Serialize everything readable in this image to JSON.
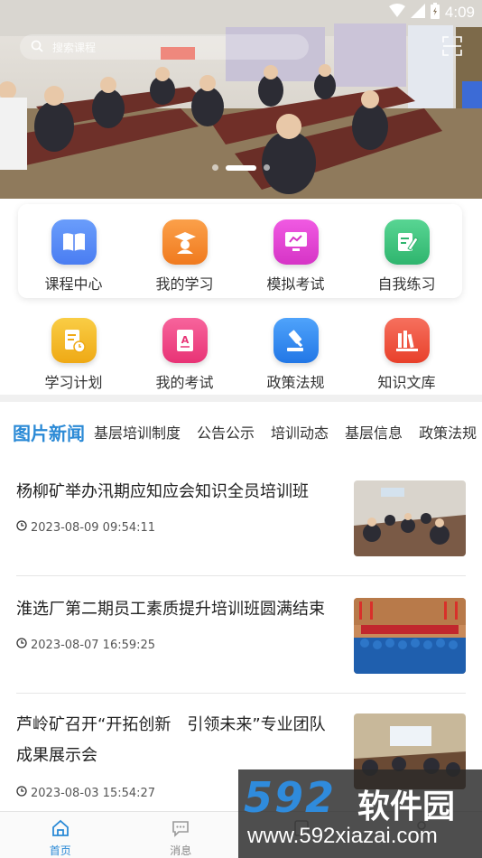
{
  "status_bar": {
    "time": "4:09"
  },
  "search": {
    "placeholder": "搜索课程"
  },
  "feature_row1": [
    {
      "label": "课程中心",
      "color": "#4f86f7",
      "icon": "book-icon"
    },
    {
      "label": "我的学习",
      "color": "#f5892b",
      "icon": "graduate-icon"
    },
    {
      "label": "模拟考试",
      "color": "#e43fd6",
      "icon": "monitor-icon"
    },
    {
      "label": "自我练习",
      "color": "#3fc37e",
      "icon": "edit-note-icon"
    }
  ],
  "feature_row2": [
    {
      "label": "学习计划",
      "color": "#f3b82a",
      "icon": "plan-icon"
    },
    {
      "label": "我的考试",
      "color": "#f04a86",
      "icon": "exam-icon"
    },
    {
      "label": "政策法规",
      "color": "#2f8ef3",
      "icon": "gavel-icon"
    },
    {
      "label": "知识文库",
      "color": "#f2543f",
      "icon": "library-icon"
    }
  ],
  "tabs": [
    "图片新闻",
    "基层培训制度",
    "公告公示",
    "培训动态",
    "基层信息",
    "政策法规"
  ],
  "news": [
    {
      "title": "杨柳矿举办汛期应知应会知识全员培训班",
      "time": "2023-08-09 09:54:11"
    },
    {
      "title": "淮选厂第二期员工素质提升培训班圆满结束",
      "time": "2023-08-07 16:59:25"
    },
    {
      "title": "芦岭矿召开“开拓创新　引领未来”专业团队成果展示会",
      "time": "2023-08-03 15:54:27"
    }
  ],
  "bottom_nav": [
    {
      "label": "首页",
      "icon": "home-icon"
    },
    {
      "label": "消息",
      "icon": "message-icon"
    },
    {
      "label": "",
      "icon": "study-icon"
    },
    {
      "label": "",
      "icon": "profile-icon"
    }
  ],
  "watermark": {
    "logo": "592",
    "name": "软件园",
    "url": "www.592xiazai.com"
  },
  "colors": {
    "accent": "#2b8ad6",
    "tab_indicator": "#e53935"
  }
}
